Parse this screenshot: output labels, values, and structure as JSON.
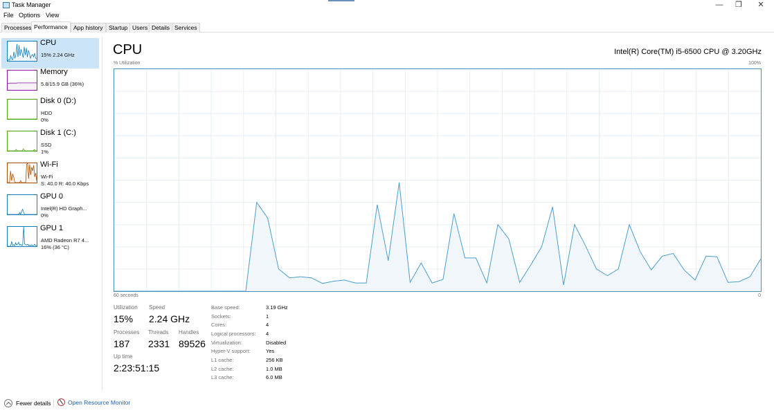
{
  "window": {
    "title": "Task Manager",
    "controls": {
      "minimize": "—",
      "restore": "❐",
      "close": "✕"
    }
  },
  "menu": [
    "File",
    "Options",
    "View"
  ],
  "tabs": [
    {
      "label": "Processes",
      "active": false
    },
    {
      "label": "Performance",
      "active": true
    },
    {
      "label": "App history",
      "active": false
    },
    {
      "label": "Startup",
      "active": false
    },
    {
      "label": "Users",
      "active": false
    },
    {
      "label": "Details",
      "active": false
    },
    {
      "label": "Services",
      "active": false
    }
  ],
  "sidebar": {
    "items": [
      {
        "name": "CPU",
        "line1": "15% 2.24 GHz",
        "line2": "",
        "color": "#117dbb",
        "fill": "#f1f6fa",
        "active": true,
        "spark": [
          0,
          2,
          1,
          8,
          3,
          2,
          14,
          4,
          10,
          26,
          6,
          24,
          8,
          18,
          12,
          5,
          22,
          9,
          20,
          6,
          16,
          12,
          4,
          8,
          10,
          6,
          12,
          4,
          3
        ]
      },
      {
        "name": "Memory",
        "line1": "5.8/15.9 GB (36%)",
        "line2": "",
        "color": "#8b12ae",
        "fill": "#f4f2f4",
        "active": false,
        "spark": [
          34,
          35,
          35,
          35,
          35,
          36,
          36,
          36,
          36,
          36,
          36,
          36,
          36,
          36,
          36
        ]
      },
      {
        "name": "Disk 0 (D:)",
        "line1": "HDD",
        "line2": "0%",
        "color": "#4da60c",
        "fill": "#eff6eb",
        "active": false,
        "spark": [
          0,
          0,
          0,
          0,
          0,
          0,
          0,
          0,
          0,
          0
        ]
      },
      {
        "name": "Disk 1 (C:)",
        "line1": "SSD",
        "line2": "1%",
        "color": "#4da60c",
        "fill": "#eff6eb",
        "active": false,
        "spark": [
          0,
          0,
          0,
          0,
          0,
          0,
          0,
          2,
          0,
          0,
          0,
          0,
          0,
          3,
          0,
          0,
          0,
          0,
          0,
          0,
          0,
          0,
          2,
          0,
          0
        ]
      },
      {
        "name": "Wi-Fi",
        "line1": "Wi-Fi",
        "line2": "S: 40.0 R: 40.0 Kbps",
        "color": "#a74f01",
        "fill": "#fcf3eb",
        "active": false,
        "spark": [
          0,
          0,
          5,
          60,
          10,
          45,
          30,
          5,
          0,
          0,
          0,
          0,
          0,
          10,
          0,
          0,
          0,
          0,
          0,
          95,
          100,
          20,
          95,
          40,
          80,
          60,
          90,
          30,
          50,
          10
        ]
      },
      {
        "name": "GPU 0",
        "line1": "Intel(R) HD Graph...",
        "line2": "0%",
        "color": "#117dbb",
        "fill": "#f1f6fa",
        "active": false,
        "spark": [
          0,
          0,
          0,
          0,
          0,
          0,
          0,
          0,
          0,
          0,
          0,
          0,
          3,
          0,
          5,
          8,
          3,
          0,
          0,
          0,
          0,
          0,
          0,
          0,
          0,
          0,
          0,
          0,
          0,
          0
        ]
      },
      {
        "name": "GPU 1",
        "line1": "AMD Radeon R7 4...",
        "line2": "16% (36 °C)",
        "color": "#117dbb",
        "fill": "#f1f6fa",
        "active": false,
        "spark": [
          0,
          0,
          0,
          0,
          25,
          4,
          8,
          3,
          18,
          6,
          12,
          20,
          6,
          10,
          4,
          5,
          100,
          12,
          8,
          6,
          10,
          4,
          6,
          3,
          8,
          2,
          4,
          10,
          3,
          2
        ]
      }
    ]
  },
  "cpu": {
    "title": "CPU",
    "model": "Intel(R) Core(TM) i5-6500 CPU @ 3.20GHz",
    "graph": {
      "ylabel": "% Utilization",
      "ymax_label": "100%",
      "xlabel": "60 seconds",
      "xmin_label": "0"
    },
    "stats": {
      "utilization_label": "Utilization",
      "utilization": "15%",
      "speed_label": "Speed",
      "speed": "2.24 GHz",
      "processes_label": "Processes",
      "processes": "187",
      "threads_label": "Threads",
      "threads": "2331",
      "handles_label": "Handles",
      "handles": "89526",
      "uptime_label": "Up time",
      "uptime": "2:23:51:15"
    },
    "specs": [
      {
        "label": "Base speed:",
        "value": "3.19 GHz"
      },
      {
        "label": "Sockets:",
        "value": "1"
      },
      {
        "label": "Cores:",
        "value": "4"
      },
      {
        "label": "Logical processors:",
        "value": "4"
      },
      {
        "label": "Virtualization:",
        "value": "Disabled"
      },
      {
        "label": "Hyper-V support:",
        "value": "Yes"
      },
      {
        "label": "L1 cache:",
        "value": "256 KB"
      },
      {
        "label": "L2 cache:",
        "value": "1.0 MB"
      },
      {
        "label": "L3 cache:",
        "value": "6.0 MB"
      }
    ]
  },
  "footer": {
    "fewer_details": "Fewer details",
    "resource_monitor": "Open Resource Monitor"
  },
  "chart_data": {
    "type": "area",
    "title": "CPU % Utilization",
    "xlabel": "60 seconds",
    "ylabel": "% Utilization",
    "ylim": [
      0,
      100
    ],
    "xlim": [
      60,
      0
    ],
    "grid": true,
    "grid_columns": 20,
    "grid_rows": 10,
    "color": "#117dbb",
    "fill": "#f1f6fa",
    "values": [
      0,
      0,
      0,
      0,
      0,
      0,
      0,
      0,
      0,
      0,
      0,
      0,
      0,
      40,
      33,
      10,
      6,
      6.5,
      6,
      3.5,
      4.5,
      5,
      3.7,
      3.7,
      39,
      13.7,
      49,
      4,
      12.7,
      3.7,
      5.3,
      35,
      15,
      15,
      3.7,
      30,
      23.6,
      4,
      11.8,
      20,
      38,
      2.8,
      30,
      20.5,
      10,
      7,
      10,
      30,
      17.7,
      9.6,
      15.8,
      17,
      9.6,
      5,
      15.8,
      15.5,
      4,
      4.3,
      6.5,
      14.6
    ]
  }
}
